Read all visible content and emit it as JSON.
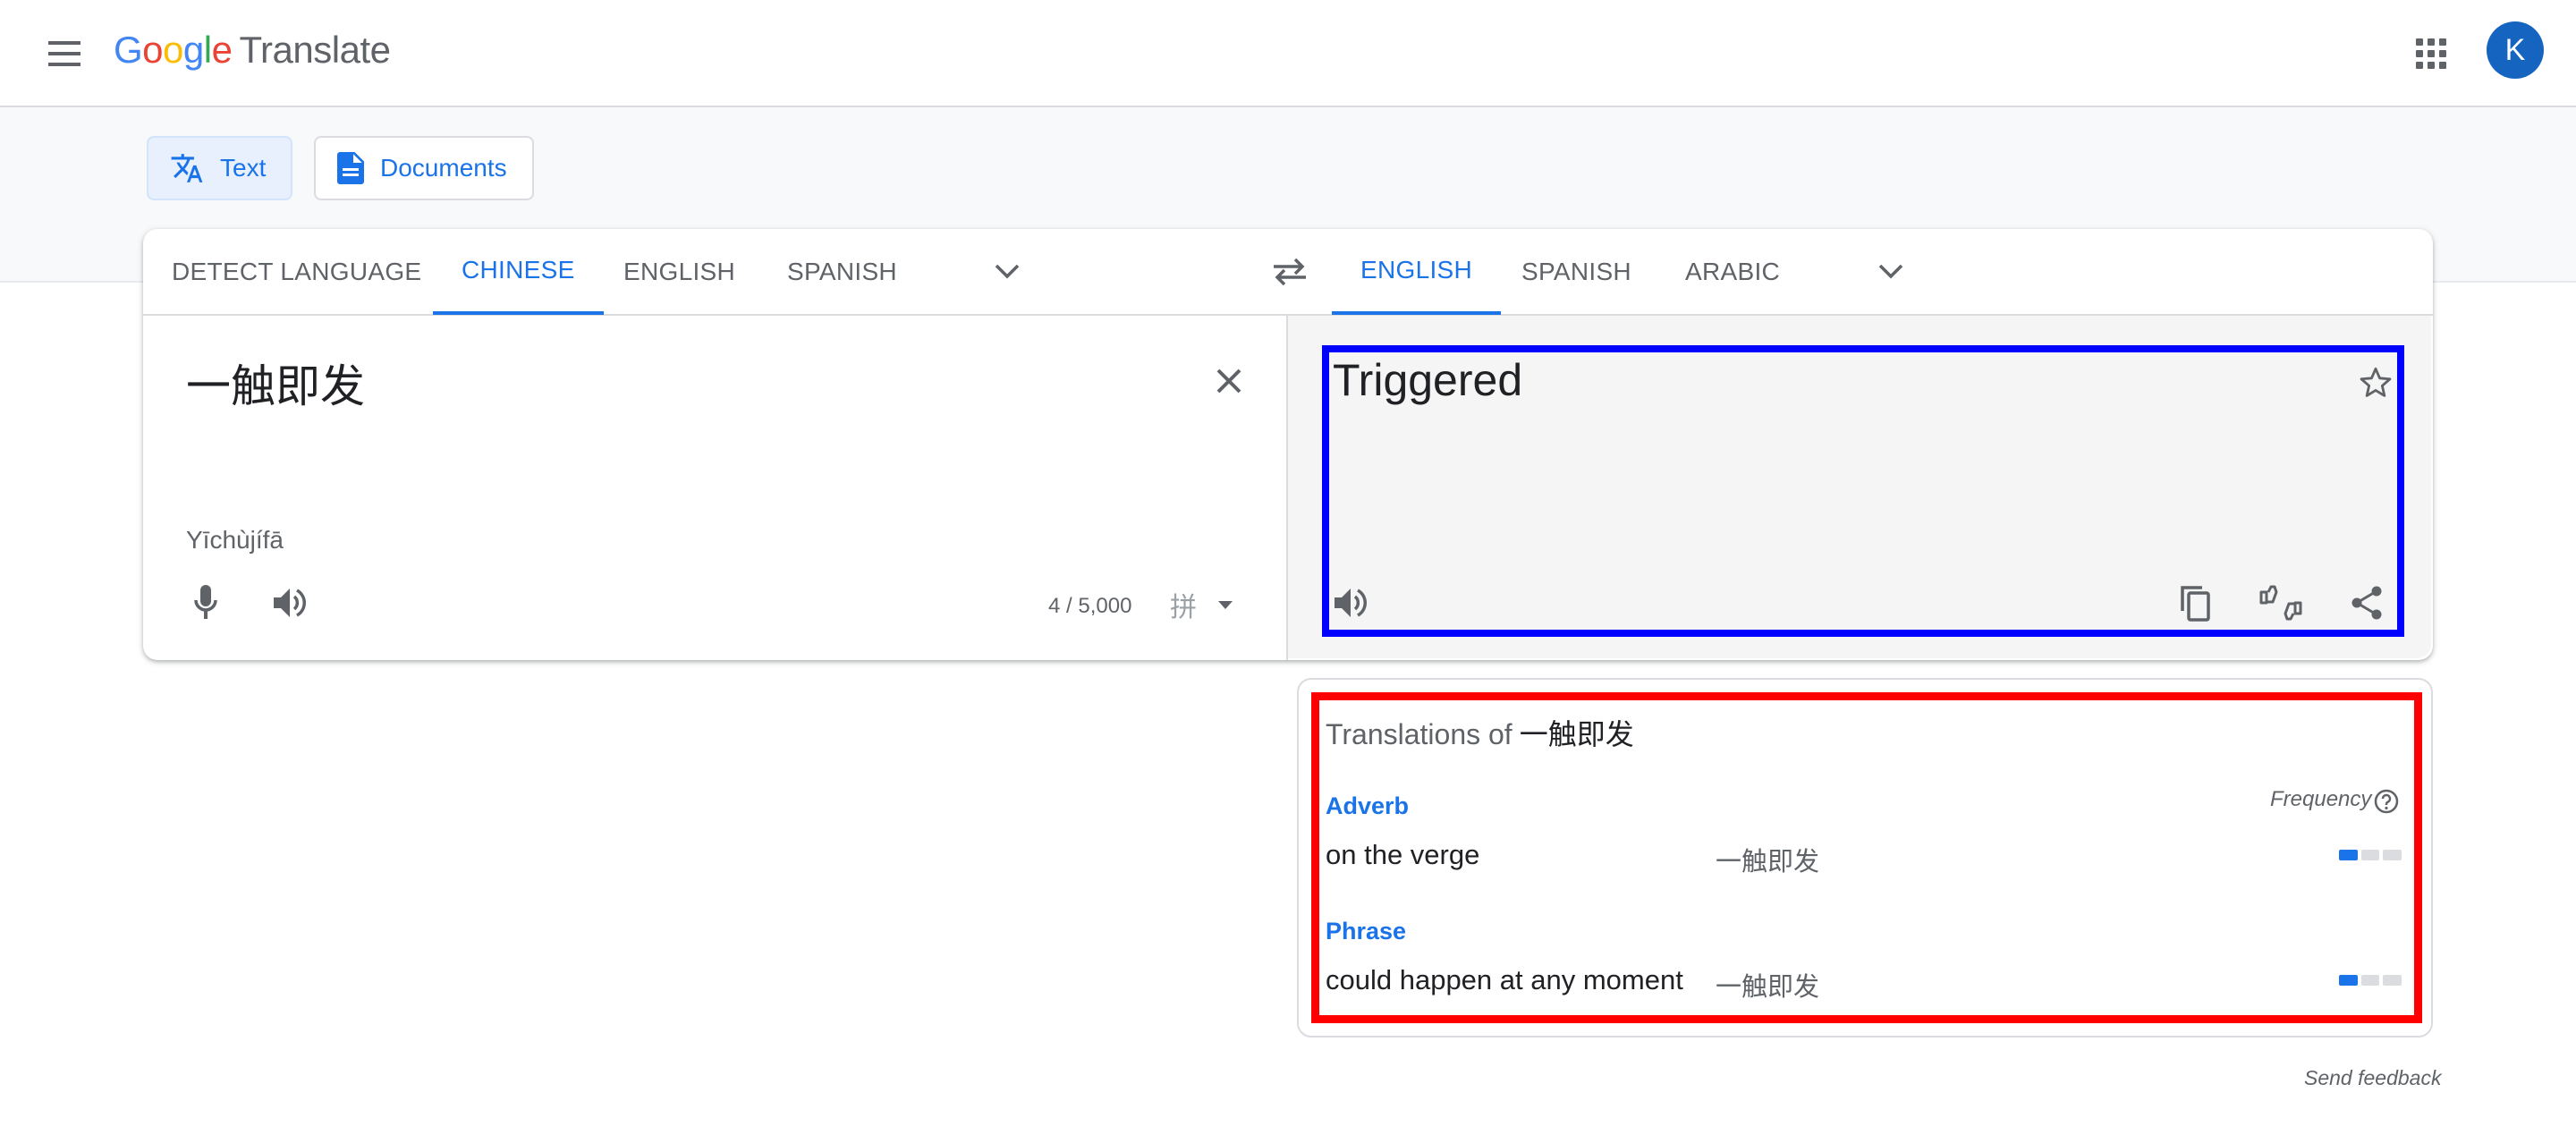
{
  "header": {
    "logo_letters": [
      "G",
      "o",
      "o",
      "g",
      "l",
      "e"
    ],
    "logo_colors": [
      "#4285f4",
      "#ea4335",
      "#fbbc05",
      "#4285f4",
      "#34a853",
      "#ea4335"
    ],
    "product_name": "Translate",
    "avatar_initial": "K",
    "avatar_color": "#1565c0"
  },
  "modes": [
    {
      "label": "Text",
      "icon": "translate-icon",
      "active": true
    },
    {
      "label": "Documents",
      "icon": "document-icon",
      "active": false
    }
  ],
  "source_languages": {
    "tabs": [
      "DETECT LANGUAGE",
      "CHINESE",
      "ENGLISH",
      "SPANISH"
    ],
    "active": "CHINESE"
  },
  "target_languages": {
    "tabs": [
      "ENGLISH",
      "SPANISH",
      "ARABIC"
    ],
    "active": "ENGLISH"
  },
  "source": {
    "text": "一触即发",
    "romanization": "Yīchùjífā",
    "char_count": "4 / 5,000",
    "ime_label": "拼"
  },
  "target": {
    "text": "Triggered"
  },
  "dictionary": {
    "title_prefix": "Translations of",
    "title_word": "一触即发",
    "frequency_label": "Frequency",
    "groups": [
      {
        "pos": "Adverb",
        "entries": [
          {
            "translation": "on the verge",
            "synonyms": "一触即发",
            "frequency": 1
          }
        ]
      },
      {
        "pos": "Phrase",
        "entries": [
          {
            "translation": "could happen at any moment",
            "synonyms": "一触即发",
            "frequency": 1
          }
        ]
      }
    ]
  },
  "footer": {
    "send_feedback": "Send feedback"
  },
  "colors": {
    "accent": "#1a73e8",
    "highlight_target": "#0000ff",
    "highlight_dictionary": "#ff0000"
  }
}
